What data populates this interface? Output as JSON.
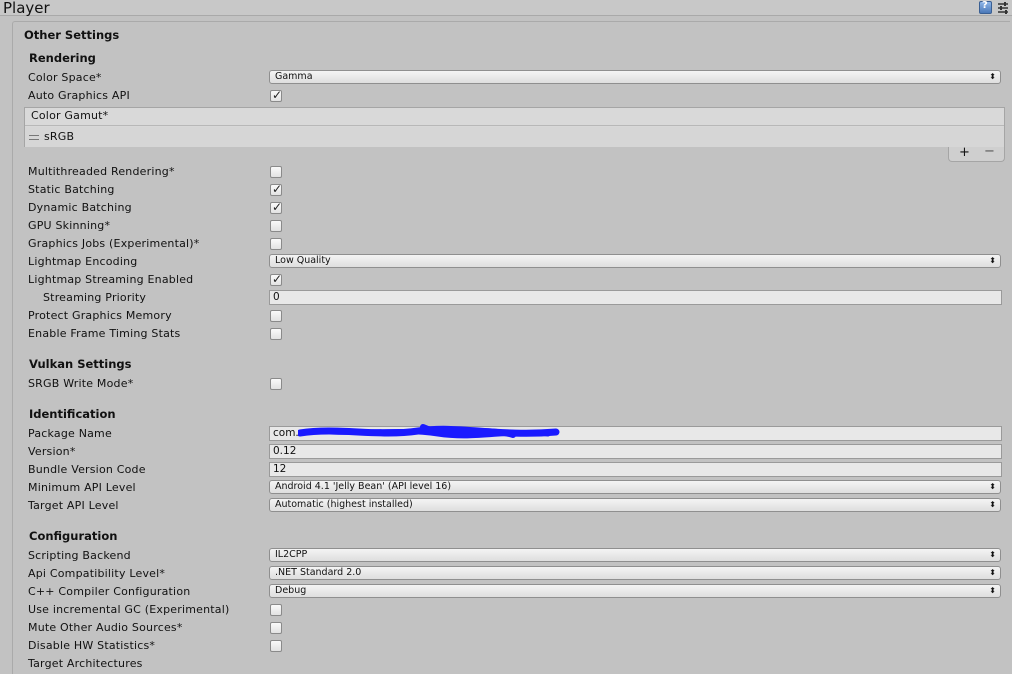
{
  "window": {
    "title": "Player"
  },
  "header": {
    "title": "Other Settings"
  },
  "rendering": {
    "title": "Rendering",
    "color_space": {
      "label": "Color Space*",
      "value": "Gamma"
    },
    "auto_graphics_api": {
      "label": "Auto Graphics API",
      "checked": true
    },
    "color_gamut": {
      "label": "Color Gamut*",
      "items": [
        "sRGB"
      ]
    },
    "multithreaded": {
      "label": "Multithreaded Rendering*",
      "checked": false
    },
    "static_batching": {
      "label": "Static Batching",
      "checked": true
    },
    "dynamic_batching": {
      "label": "Dynamic Batching",
      "checked": true
    },
    "gpu_skinning": {
      "label": "GPU Skinning*",
      "checked": false
    },
    "graphics_jobs": {
      "label": "Graphics Jobs (Experimental)*",
      "checked": false
    },
    "lightmap_encoding": {
      "label": "Lightmap Encoding",
      "value": "Low Quality"
    },
    "lightmap_streaming": {
      "label": "Lightmap Streaming Enabled",
      "checked": true
    },
    "streaming_priority": {
      "label": "Streaming Priority",
      "value": "0"
    },
    "protect_graphics_memory": {
      "label": "Protect Graphics Memory",
      "checked": false
    },
    "frame_timing_stats": {
      "label": "Enable Frame Timing Stats",
      "checked": false
    }
  },
  "vulkan": {
    "title": "Vulkan Settings",
    "srgb_write_mode": {
      "label": "SRGB Write Mode*",
      "checked": false
    }
  },
  "identification": {
    "title": "Identification",
    "package_name": {
      "label": "Package Name",
      "value": "com."
    },
    "version": {
      "label": "Version*",
      "value": "0.12"
    },
    "bundle_version_code": {
      "label": "Bundle Version Code",
      "value": "12"
    },
    "min_api_level": {
      "label": "Minimum API Level",
      "value": "Android 4.1 'Jelly Bean' (API level 16)"
    },
    "target_api_level": {
      "label": "Target API Level",
      "value": "Automatic (highest installed)"
    }
  },
  "configuration": {
    "title": "Configuration",
    "scripting_backend": {
      "label": "Scripting Backend",
      "value": "IL2CPP"
    },
    "api_compat": {
      "label": "Api Compatibility Level*",
      "value": ".NET Standard 2.0"
    },
    "cpp_compiler": {
      "label": "C++ Compiler Configuration",
      "value": "Debug"
    },
    "incremental_gc": {
      "label": "Use incremental GC (Experimental)",
      "checked": false
    },
    "mute_audio": {
      "label": "Mute Other Audio Sources*",
      "checked": false
    },
    "disable_hw_stats": {
      "label": "Disable HW Statistics*",
      "checked": false
    },
    "target_architectures": {
      "label": "Target Architectures"
    }
  },
  "list_controls": {
    "add": "+",
    "remove": "−"
  },
  "colors": {
    "redaction": "#1a1aff",
    "panel_bg": "#c2c2c2"
  },
  "icons": {
    "help": "help-book-icon",
    "settings": "settings-sliders-icon"
  }
}
